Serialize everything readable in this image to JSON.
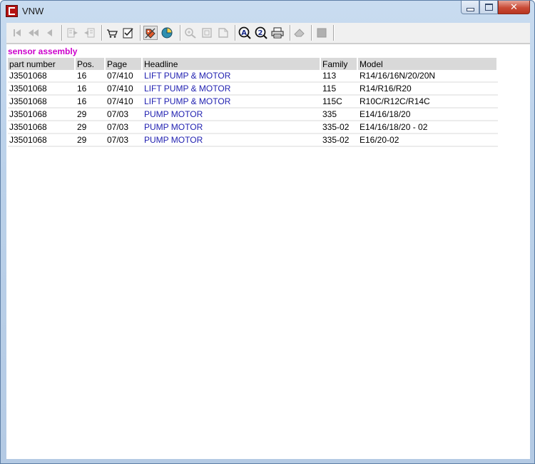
{
  "window": {
    "title": "VNW",
    "icon": "app-logo-icon"
  },
  "caption_buttons": [
    "minimize-icon",
    "maximize-icon",
    "close-icon"
  ],
  "toolbar": {
    "buttons": [
      {
        "name": "first-record-icon",
        "enabled": false
      },
      {
        "name": "previous-page-icon",
        "enabled": false
      },
      {
        "name": "previous-record-icon",
        "enabled": false
      },
      {
        "name": "export-left-icon",
        "enabled": false
      },
      {
        "name": "export-right-icon",
        "enabled": false
      },
      {
        "name": "cart-icon",
        "enabled": true
      },
      {
        "name": "checklist-icon",
        "enabled": true
      },
      {
        "name": "tag-icon",
        "enabled": true,
        "pressed": true
      },
      {
        "name": "pie-chart-icon",
        "enabled": true
      },
      {
        "name": "zoom-in-icon",
        "enabled": false
      },
      {
        "name": "page-icon",
        "enabled": false
      },
      {
        "name": "page-fold-icon",
        "enabled": false
      },
      {
        "name": "search-a-icon",
        "enabled": true
      },
      {
        "name": "search-2-icon",
        "enabled": true
      },
      {
        "name": "print-icon",
        "enabled": true
      },
      {
        "name": "eraser-icon",
        "enabled": false
      },
      {
        "name": "stop-icon",
        "enabled": false
      }
    ]
  },
  "section_title": "sensor assembly",
  "table": {
    "columns": [
      "part number",
      "Pos.",
      "Page",
      "Headline",
      "Family",
      "Model"
    ],
    "rows": [
      [
        "J3501068",
        "16",
        "07/410",
        "LIFT PUMP & MOTOR",
        "113",
        "R14/16/16N/20/20N"
      ],
      [
        "J3501068",
        "16",
        "07/410",
        "LIFT PUMP & MOTOR",
        "115",
        "R14/R16/R20"
      ],
      [
        "J3501068",
        "16",
        "07/410",
        "LIFT PUMP & MOTOR",
        "115C",
        "R10C/R12C/R14C"
      ],
      [
        "J3501068",
        "29",
        "07/03",
        "PUMP MOTOR",
        "335",
        "E14/16/18/20"
      ],
      [
        "J3501068",
        "29",
        "07/03",
        "PUMP MOTOR",
        "335-02",
        "E14/16/18/20 - 02"
      ],
      [
        "J3501068",
        "29",
        "07/03",
        "PUMP MOTOR",
        "335-02",
        "E16/20-02"
      ]
    ]
  },
  "colors": {
    "section_title": "#cc00cc",
    "link_text": "#1f1fb0",
    "header_bg": "#d9d9d9"
  }
}
